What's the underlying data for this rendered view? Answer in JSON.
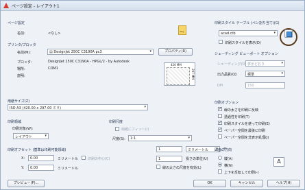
{
  "window": {
    "title": "ページ設定 - レイアウト1"
  },
  "page_setup": {
    "section": "ページ設定",
    "name_label": "名前:",
    "name_value": "<なし>"
  },
  "printer": {
    "section": "プリンタ/プロッタ",
    "name_label": "名前(M):",
    "name_value": "DesignJet 250C C3190A pc3",
    "props_button": "プロパティ(R)",
    "plotter_label": "プロッタ:",
    "plotter_value": "DesignJet 250C C3190A - HPGL/2 - by Autodesk",
    "where_label": "場所:",
    "where_value": "COM1",
    "desc_label": "説明:",
    "preview_w": "420 MM",
    "preview_h": "297 MM"
  },
  "paper": {
    "section": "用紙サイズ(Z)",
    "value": "ISO A3 (420.00 x 297.00 ミリ)"
  },
  "plot_area": {
    "section": "印刷領域",
    "label": "印刷対象(W):",
    "value": "レイアウト"
  },
  "scale": {
    "section": "印刷尺度",
    "fit_label": "用紙にフィット(I)",
    "scale_label": "尺度(S):",
    "scale_value": "1:1",
    "unit_value1": "1",
    "unit_label1": "ミリメートル",
    "equal": "=",
    "unit_value2": "1",
    "unit_label2": "長さの単位(U)",
    "lineweights_label": "線の太さの尺度を有効(L)"
  },
  "offset": {
    "section": "印刷オフセット (基準は印刷可能領域)",
    "x_label": "X:",
    "x_value": "0.00",
    "x_unit": "ミリメートル",
    "center_label": "印刷の中心(C)",
    "y_label": "Y:",
    "y_value": "0.00",
    "y_unit": "ミリメートル"
  },
  "style_table": {
    "section": "印刷スタイル テーブル (ペン割り当て)(G)",
    "value": "acad.ctb",
    "display_label": "印刷スタイルを表示(D)"
  },
  "shaded": {
    "section": "シェーディング ビューポート オプション",
    "shade_label": "シェーディング(D):",
    "shade_value": "表示どおり",
    "quality_label": "出力品質(Q):",
    "quality_value": "標準",
    "dpi_label": "DPI",
    "dpi_value": "150"
  },
  "plot_options": {
    "section": "印刷オプション",
    "items": [
      "線の太さを印刷に反映",
      "透過性を印刷(T)",
      "印刷スタイルを使って印刷(E)",
      "ペーパー空間を最後に印刷",
      "ペーパー空間を非表示処理(J)"
    ],
    "checked": [
      true,
      false,
      true,
      true,
      false
    ]
  },
  "orientation": {
    "section": "図面の方向",
    "portrait": "縦(A)",
    "landscape": "横(N)",
    "upside": "上下を反転して印刷(-)",
    "icon": "A"
  },
  "footer": {
    "preview": "プレビュー(P)...",
    "ok": "OK",
    "cancel": "キャンセル",
    "help": "ヘルプ(H)"
  },
  "icons": {
    "app": "autocad-logo-icon",
    "dwg": "dwg-file-icon",
    "edit": "edit-style-table-icon"
  },
  "accent": "#5a3a1a"
}
